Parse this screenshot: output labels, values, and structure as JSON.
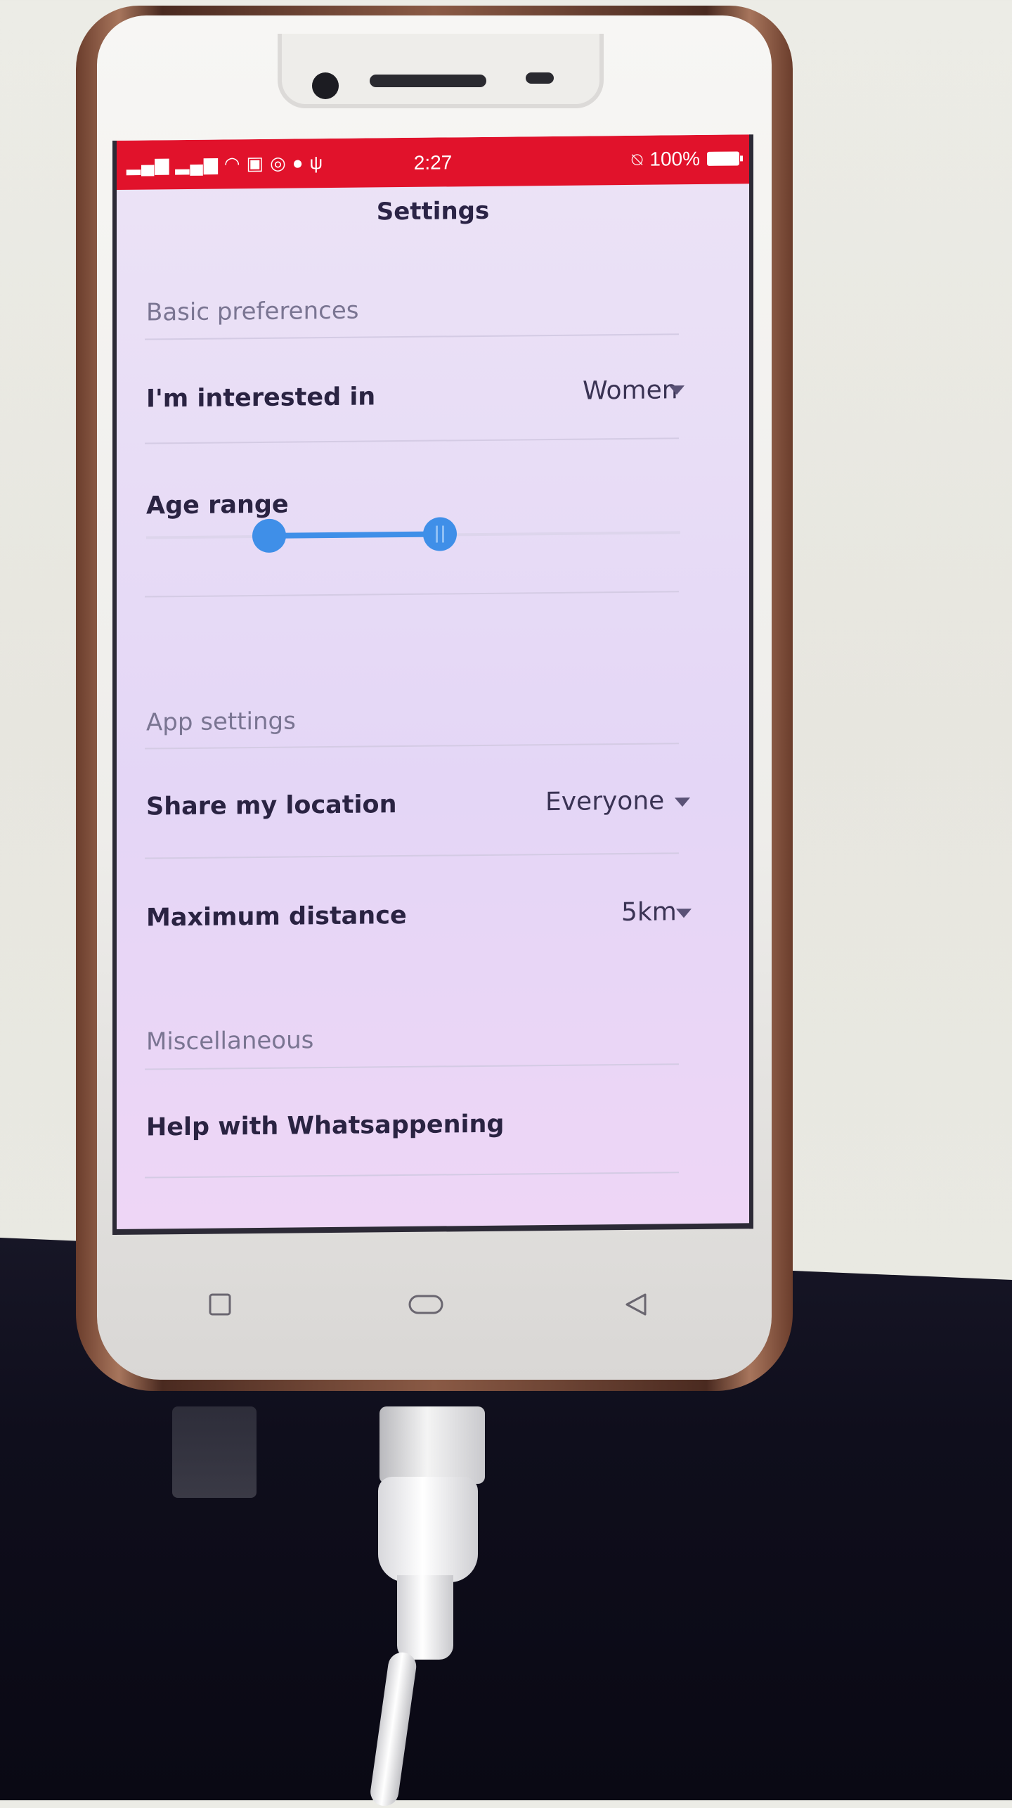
{
  "status_bar": {
    "time": "2:27",
    "battery": "100%",
    "left_icons": [
      "signal-icon",
      "signal-icon",
      "wifi-icon",
      "notification-icon",
      "whatsapp-icon",
      "cat-icon",
      "usb-icon"
    ],
    "right_icons": [
      "mute-icon",
      "battery-icon"
    ]
  },
  "header": {
    "title": "Settings"
  },
  "basic_preferences": {
    "header": "Basic preferences",
    "interested_in": {
      "label": "I'm interested in",
      "value": "Women"
    },
    "age_range": {
      "label": "Age range",
      "min_fraction": 0.23,
      "max_fraction": 0.55
    }
  },
  "app_settings": {
    "header": "App settings",
    "share_location": {
      "label": "Share my location",
      "value": "Everyone"
    },
    "max_distance": {
      "label": "Maximum distance",
      "value": "5km"
    }
  },
  "miscellaneous": {
    "header": "Miscellaneous",
    "help": {
      "label": "Help with Whatsappening"
    }
  },
  "colors": {
    "status_bar": "#e1122b",
    "accent": "#3f8fe8",
    "screen_background": "#e8ddf6"
  },
  "nav_keys": [
    "recent-apps-icon",
    "home-icon",
    "back-icon"
  ]
}
